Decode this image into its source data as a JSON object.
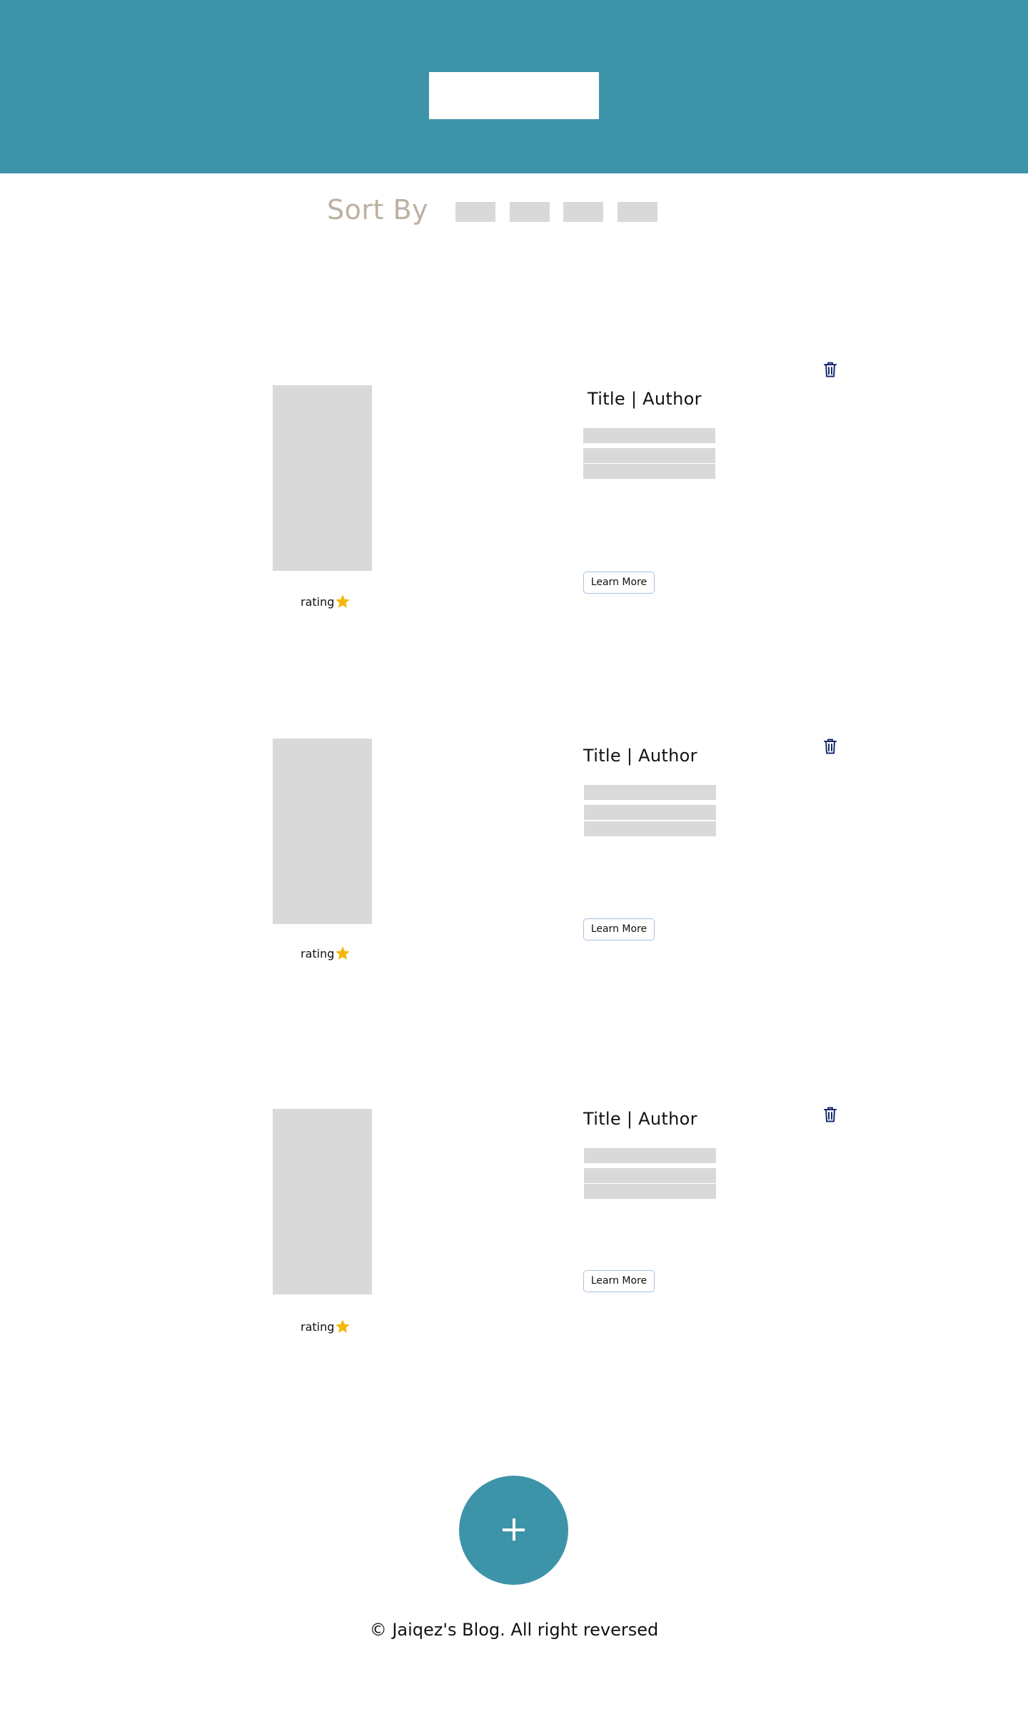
{
  "sort": {
    "label": "Sort By",
    "options": [
      "",
      "",
      "",
      ""
    ]
  },
  "posts": [
    {
      "title": "Title | Author",
      "rating_label": "rating",
      "learn_more": "Learn More"
    },
    {
      "title": "Title | Author",
      "rating_label": "rating",
      "learn_more": "Learn More"
    },
    {
      "title": "Title | Author",
      "rating_label": "rating",
      "learn_more": "Learn More"
    }
  ],
  "icons": {
    "delete": "trash-icon",
    "rating": "star-icon",
    "add": "plus-icon"
  },
  "colors": {
    "header": "#3d94a9",
    "placeholder": "#d9d9d9",
    "sort_label": "#bcb0a0",
    "star": "#f5b70b",
    "trash": "#1a2a72",
    "button_border": "#a9c2df"
  },
  "footer": {
    "copyright": "© Jaiqez's Blog. All right reversed"
  }
}
